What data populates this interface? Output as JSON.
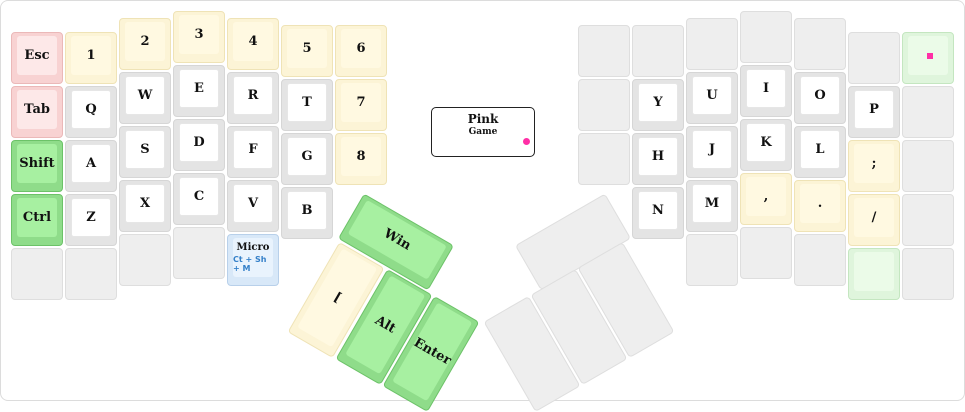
{
  "left_keys": {
    "esc": "Esc",
    "tab": "Tab",
    "shift": "Shift",
    "ctrl": "Ctrl",
    "n1": "1",
    "q": "Q",
    "a": "A",
    "z": "Z",
    "n2": "2",
    "w": "W",
    "s": "S",
    "x": "X",
    "n3": "3",
    "e": "E",
    "d": "D",
    "c": "C",
    "n4": "4",
    "r": "R",
    "f": "F",
    "v": "V",
    "n5": "5",
    "t": "T",
    "g": "G",
    "b": "B",
    "n6": "6",
    "n7": "7",
    "n8": "8",
    "micro": "Micro",
    "micro_sub": "Ct + Sh + M"
  },
  "left_thumb": {
    "win": "Win",
    "bracket": "[",
    "alt": "Alt",
    "enter": "Enter"
  },
  "right_keys": {
    "y": "Y",
    "h": "H",
    "n": "N",
    "u": "U",
    "j": "J",
    "m": "M",
    "i": "I",
    "k": "K",
    "comma": ",",
    "o": "O",
    "l": "L",
    "period": ".",
    "p": "P",
    "semicolon": ";",
    "slash": "/"
  },
  "layer": {
    "name": "Pink",
    "subtitle": "Game"
  },
  "colors": {
    "modifier": "#a7f0a1",
    "escape": "#fde8e8",
    "number": "#fff9e1",
    "letter": "#ffffff",
    "macro": "#e9f3fd",
    "indicator": "#ff2fa6"
  }
}
